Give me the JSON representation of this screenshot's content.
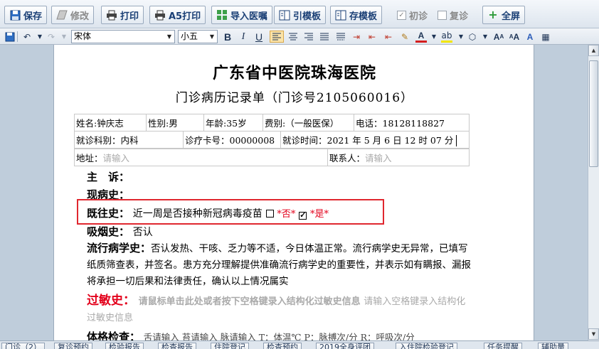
{
  "toolbar": {
    "save": "保存",
    "edit": "修改",
    "print": "打印",
    "a5_print": "A5打印",
    "import_advice": "导入医嘱",
    "load_template": "引模板",
    "save_template": "存模板",
    "first_visit": "初诊",
    "follow_up": "复诊",
    "fullscreen": "全屏"
  },
  "format_bar": {
    "font_family": "宋体",
    "font_size": "小五",
    "bold": "B",
    "italic": "I",
    "underline": "U"
  },
  "document": {
    "hospital_name": "广东省中医院珠海医院",
    "form_title": "门诊病历记录单（门诊号2105060016）",
    "info_rows": [
      [
        "姓名:钟庆志",
        "性别:男",
        "年龄:35岁",
        "费别:（一般医保）",
        "电话：18128118827"
      ],
      [
        "就诊科别：内科",
        "诊疗卡号：00000008",
        "就诊时间：2021 年 5 月 6 日 12 时 07 分"
      ],
      [
        "地址：",
        "请输入",
        "联系人：",
        "请输入"
      ]
    ],
    "chief_complaint_label": "主　诉：",
    "present_illness_label": "现病史：",
    "past_history_label": "既往史：",
    "past_history_text": "近一周是否接种新冠病毒疫苗",
    "option_no": "*否*",
    "option_yes": "*是*",
    "smoking_label": "吸烟史：",
    "smoking_value": "否认",
    "epi_label": "流行病学史：",
    "epi_text": "否认发热、干咳、乏力等不适，今日体温正常。流行病学史无异常，已填写纸质筛查表，并签名。患方充分理解提供准确流行病学史的重要性，并表示如有瞒报、漏报将承担一切后果和法律责任，确认以上情况属实",
    "allergy_label": "过敏史：",
    "allergy_hint_bold": "请鼠标单击此处或者按下空格键录入结构化过敏史信息",
    "allergy_hint_light": "请输入空格键录入结构化过敏史信息",
    "exam_label": "体格检查：",
    "exam_text": "舌请输入 苔请输入 脉请输入 T：体温℃ P：脉搏次/分 R：呼吸次/分"
  },
  "bottom_tabs": [
    "门诊（2）",
    "复诊预约",
    "检验报告",
    "检查报告",
    "住院登记",
    "检查预约",
    "2019全身评团",
    "入住院检验登记",
    "任务提醒",
    "辅助量"
  ],
  "colors": {
    "accent_blue": "#1a3f75",
    "highlight_red": "#e0272f",
    "allergy_red": "#e3001b"
  }
}
